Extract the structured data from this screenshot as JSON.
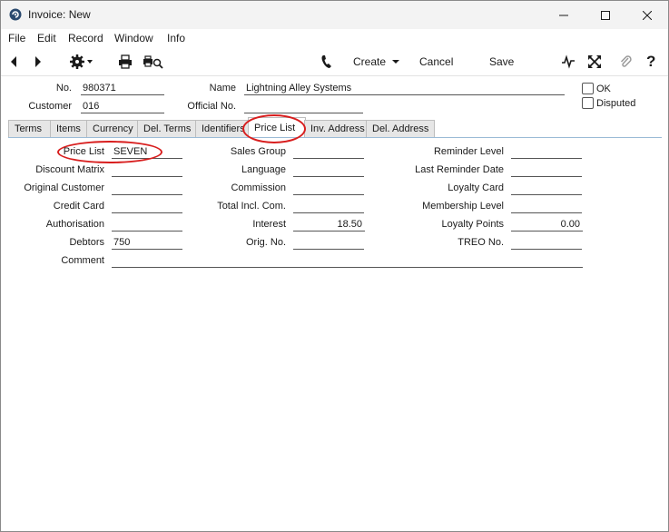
{
  "window": {
    "title": "Invoice: New"
  },
  "menu": [
    "File",
    "Edit",
    "Record",
    "Window",
    "Info"
  ],
  "toolbar": {
    "create": "Create",
    "cancel": "Cancel",
    "save": "Save"
  },
  "header": {
    "no_label": "No.",
    "no_value": "980371",
    "name_label": "Name",
    "name_value": "Lightning Alley Systems",
    "customer_label": "Customer",
    "customer_value": "016",
    "official_label": "Official No.",
    "official_value": "",
    "ok_label": "OK",
    "disputed_label": "Disputed"
  },
  "tabs": [
    "Terms",
    "Items",
    "Currency",
    "Del. Terms",
    "Identifiers",
    "Price List",
    "Inv. Address",
    "Del. Address"
  ],
  "active_tab": "Price List",
  "fields": {
    "price_list": {
      "label": "Price List",
      "value": "SEVEN"
    },
    "discount_matrix": {
      "label": "Discount Matrix",
      "value": ""
    },
    "original_customer": {
      "label": "Original Customer",
      "value": ""
    },
    "credit_card": {
      "label": "Credit Card",
      "value": ""
    },
    "authorisation": {
      "label": "Authorisation",
      "value": ""
    },
    "debtors": {
      "label": "Debtors",
      "value": "750"
    },
    "comment": {
      "label": "Comment",
      "value": ""
    },
    "sales_group": {
      "label": "Sales Group",
      "value": ""
    },
    "language": {
      "label": "Language",
      "value": ""
    },
    "commission": {
      "label": "Commission",
      "value": ""
    },
    "total_incl_com": {
      "label": "Total Incl. Com.",
      "value": ""
    },
    "interest": {
      "label": "Interest",
      "value": "18.50"
    },
    "orig_no": {
      "label": "Orig. No.",
      "value": ""
    },
    "reminder_level": {
      "label": "Reminder Level",
      "value": ""
    },
    "last_reminder_date": {
      "label": "Last Reminder Date",
      "value": ""
    },
    "loyalty_card": {
      "label": "Loyalty Card",
      "value": ""
    },
    "membership_level": {
      "label": "Membership Level",
      "value": ""
    },
    "loyalty_points": {
      "label": "Loyalty Points",
      "value": "0.00"
    },
    "treo_no": {
      "label": "TREO No.",
      "value": ""
    }
  },
  "colors": {
    "highlight": "#d81e1e",
    "tab_line": "#9bbbd6"
  }
}
